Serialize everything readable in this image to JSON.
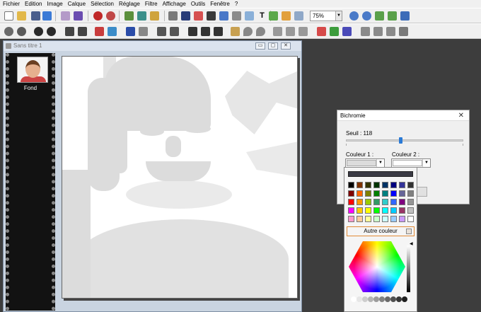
{
  "menu": [
    "Fichier",
    "Edition",
    "Image",
    "Calque",
    "Sélection",
    "Réglage",
    "Filtre",
    "Affichage",
    "Outils",
    "Fenêtre",
    "?"
  ],
  "toolbar": {
    "zoom_value": "75%"
  },
  "document": {
    "title": "Sans titre 1",
    "layer_label": "Fond",
    "min_btn": "▭",
    "max_btn": "▢",
    "close_btn": "✕"
  },
  "dialog": {
    "title": "Bichromie",
    "close": "✕",
    "seuil_label": "Seuil : 118",
    "seuil_value": 118,
    "seuil_max": 255,
    "couleur1_label": "Couleur 1 :",
    "couleur2_label": "Couleur 2 :",
    "couleur1_color": "#dcdcdc",
    "couleur2_color": "#ffffff"
  },
  "palette": {
    "autre_label": "Autre couleur",
    "colors": [
      "#000000",
      "#7f3300",
      "#333300",
      "#003300",
      "#003366",
      "#000080",
      "#333399",
      "#333333",
      "#800000",
      "#ff6600",
      "#808000",
      "#008000",
      "#008080",
      "#0000ff",
      "#666699",
      "#808080",
      "#ff0000",
      "#ff9900",
      "#99cc00",
      "#339966",
      "#33cccc",
      "#3366ff",
      "#800080",
      "#969696",
      "#ff00ff",
      "#ffcc00",
      "#ffff00",
      "#00ff00",
      "#00ffff",
      "#00ccff",
      "#993366",
      "#c0c0c0",
      "#ff99cc",
      "#ffcc99",
      "#ffff99",
      "#ccffcc",
      "#ccffff",
      "#99ccff",
      "#cc99ff",
      "#ffffff"
    ]
  },
  "icons": [
    "new-icon",
    "open-icon",
    "save-icon",
    "save-as-icon",
    "print-icon",
    "scan-icon",
    "undo-icon",
    "redo-icon",
    "cut-icon",
    "copy-icon",
    "paste-icon",
    "layers-icon",
    "crop-icon",
    "resize-icon",
    "text-icon"
  ]
}
